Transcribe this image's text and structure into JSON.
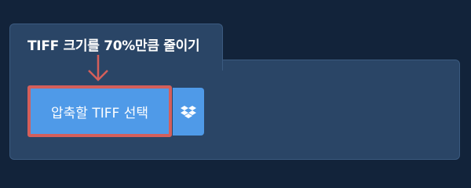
{
  "panel": {
    "title": "TIFF 크기를 70%만큼 줄이기"
  },
  "upload": {
    "select_label": "압축할 TIFF 선택",
    "dropbox_icon": "dropbox-icon"
  },
  "colors": {
    "background": "#12233a",
    "panel": "#2a4566",
    "button": "#4f9ae8",
    "highlight": "#d45f5b"
  }
}
